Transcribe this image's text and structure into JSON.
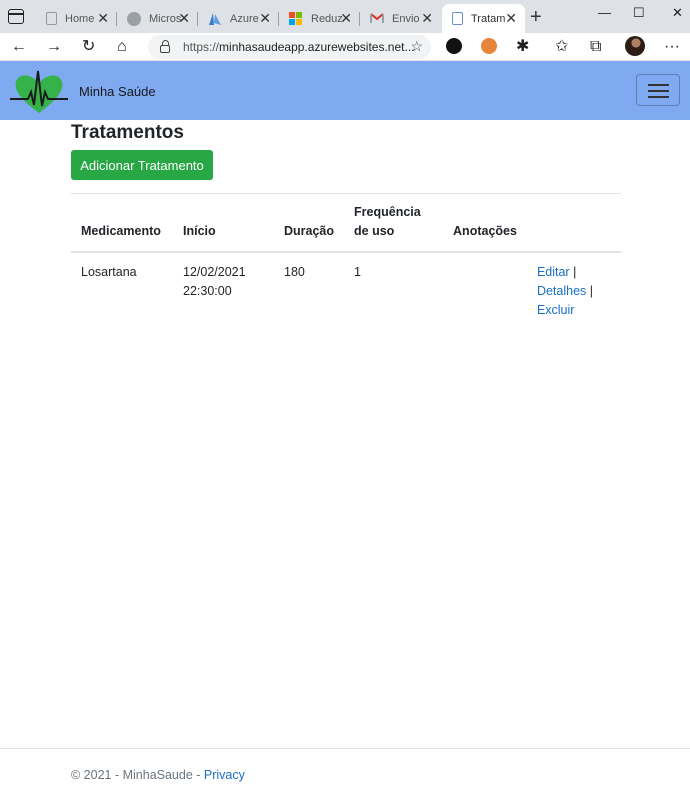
{
  "browser": {
    "tabs": [
      {
        "title": "Home",
        "icon": "page-icon"
      },
      {
        "title": "Micros",
        "icon": "ms-learn-icon"
      },
      {
        "title": "Azure",
        "icon": "azure-icon"
      },
      {
        "title": "Reduz",
        "icon": "microsoft-icon"
      },
      {
        "title": "Envio",
        "icon": "gmail-icon"
      },
      {
        "title": "Tratam",
        "icon": "page-icon",
        "active": true
      }
    ],
    "url_scheme": "https://",
    "url_host": "minhasaudeapp.azurewebsites.net..."
  },
  "navbar": {
    "brand": "Minha Saúde",
    "color": "#7fa9f0"
  },
  "page": {
    "title": "Tratamentos",
    "add_button": "Adicionar Tratamento",
    "add_button_color": "#28a745"
  },
  "table": {
    "headers": [
      "Medicamento",
      "Início",
      "Duração",
      "Frequência de uso",
      "Anotações",
      ""
    ],
    "rows": [
      {
        "medicamento": "Losartana",
        "inicio": "12/02/2021 22:30:00",
        "duracao": "180",
        "frequencia": "1",
        "anotacoes": "",
        "actions": {
          "edit": "Editar",
          "details": "Detalhes",
          "delete": "Excluir",
          "separator": "|"
        }
      }
    ]
  },
  "footer": {
    "copyright": "© 2021 - MinhaSaude - ",
    "privacy": "Privacy"
  },
  "colors": {
    "link": "#1b6ec2"
  }
}
